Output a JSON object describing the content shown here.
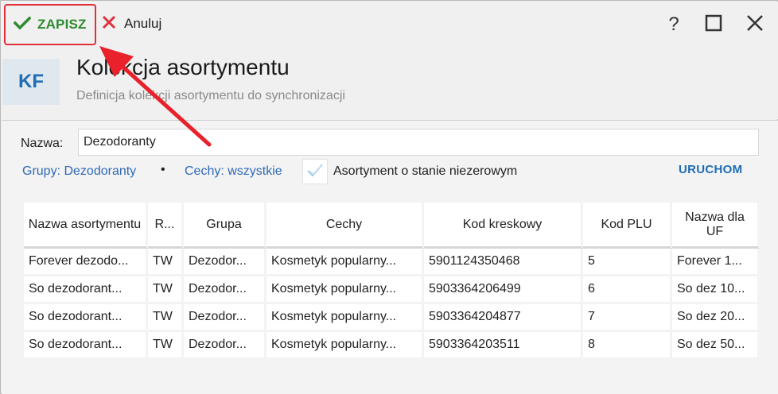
{
  "toolbar": {
    "save_label": "ZAPISZ",
    "cancel_label": "Anuluj",
    "help_label": "?"
  },
  "header": {
    "logo_text": "KF",
    "title": "Kolekcja asortymentu",
    "subtitle": "Definicja kolekcji asortymentu do synchronizacji"
  },
  "form": {
    "name_label": "Nazwa:",
    "name_value": "Dezodoranty",
    "groups_link": "Grupy: Dezodoranty",
    "bullet": "•",
    "features_link": "Cechy: wszystkie",
    "nonzero_stock_label": "Asortyment o stanie niezerowym",
    "nonzero_stock_checked": true,
    "run_label": "URUCHOM"
  },
  "table": {
    "columns": [
      "Nazwa asortymentu",
      "R...",
      "Grupa",
      "Cechy",
      "Kod kreskowy",
      "Kod PLU",
      "Nazwa dla UF"
    ],
    "rows": [
      [
        "Forever dezodo...",
        "TW",
        "Dezodor...",
        "Kosmetyk popularny...",
        "5901124350468",
        "5",
        "Forever 1..."
      ],
      [
        "So dezodorant...",
        "TW",
        "Dezodor...",
        "Kosmetyk popularny...",
        "5903364206499",
        "6",
        "So dez 10..."
      ],
      [
        "So dezodorant...",
        "TW",
        "Dezodor...",
        "Kosmetyk popularny...",
        "5903364204877",
        "7",
        "So dez 20..."
      ],
      [
        "So dezodorant...",
        "TW",
        "Dezodor...",
        "Kosmetyk popularny...",
        "5903364203511",
        "8",
        "So dez 50..."
      ]
    ]
  },
  "colors": {
    "accent_blue": "#1f6db5",
    "save_green": "#2e8b2e",
    "highlight_red": "#e0303a"
  }
}
